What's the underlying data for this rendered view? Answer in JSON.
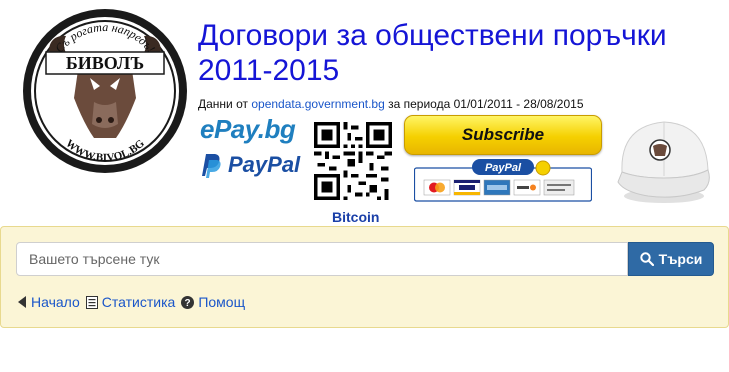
{
  "header": {
    "title": "Договори за обществени поръчки 2011-2015",
    "source_prefix": "Данни от",
    "source_link": "opendata.government.bg",
    "source_suffix": "за периода 01/01/2011 - 28/08/2015"
  },
  "logo": {
    "top_text": "Съ рогата напредъ!",
    "name": "БИВОЛЪ",
    "url": "WWW.BIVOL.BG"
  },
  "donations": {
    "epay_label": "ePay.bg",
    "paypal_label": "PayPal",
    "bitcoin_label": "Bitcoin",
    "subscribe_label": "Subscribe",
    "paypal_badge_label": "PayPal"
  },
  "search": {
    "placeholder": "Вашето търсене тук",
    "button_label": "Търси"
  },
  "nav": {
    "home": "Начало",
    "stats": "Статистика",
    "help": "Помощ"
  },
  "colors": {
    "title": "#1515d6",
    "link": "#1a56c9",
    "panel_bg": "#fbf5d6",
    "search_btn": "#2f6aa5",
    "subscribe": "#f5d000"
  }
}
